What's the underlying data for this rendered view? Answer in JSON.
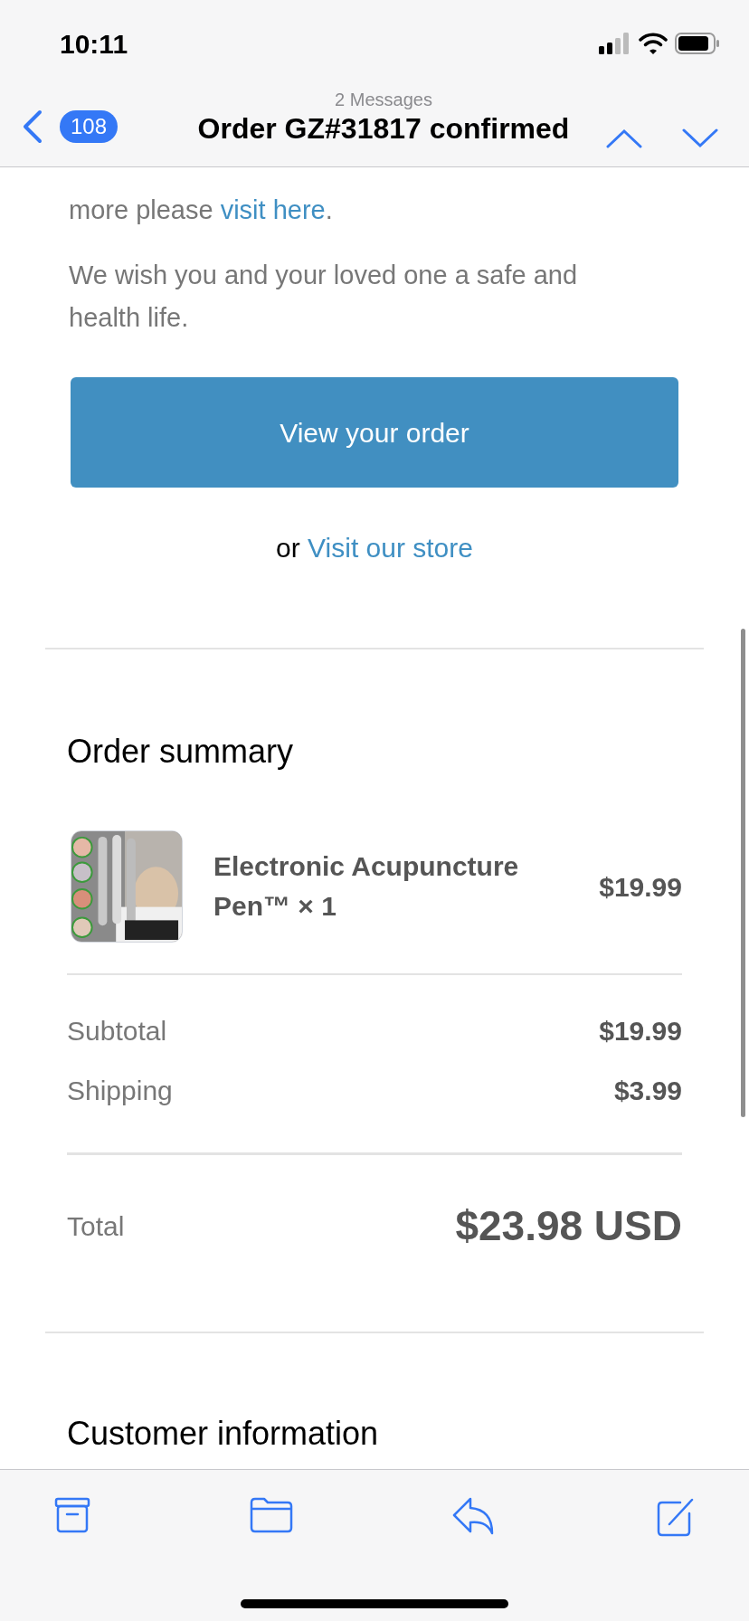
{
  "status_bar": {
    "time": "10:11"
  },
  "nav": {
    "subtitle": "2 Messages",
    "title": "Order GZ#31817 confirmed",
    "unread_count": "108"
  },
  "body": {
    "intro_prefix": "more please ",
    "intro_link": "visit here",
    "intro_suffix": ".",
    "wish": "We wish you and your loved one a safe and health life.",
    "view_order_button": "View your order",
    "store_prefix": "or ",
    "store_link": "Visit our store"
  },
  "order_summary": {
    "heading": "Order summary",
    "items": [
      {
        "name": "Electronic Acupuncture Pen™ × 1",
        "price": "$19.99"
      }
    ],
    "lines": [
      {
        "label": "Subtotal",
        "value": "$19.99"
      },
      {
        "label": "Shipping",
        "value": "$3.99"
      }
    ],
    "total": {
      "label": "Total",
      "value": "$23.98 USD"
    }
  },
  "customer_heading": "Customer information"
}
